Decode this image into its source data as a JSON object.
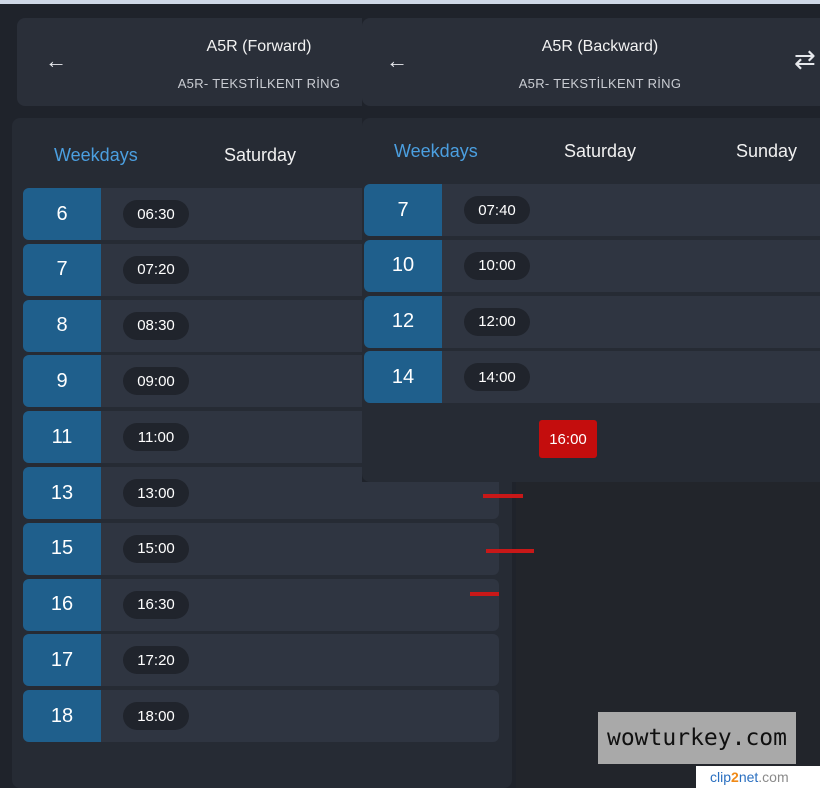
{
  "forward": {
    "title": "A5R (Forward)",
    "subtitle": "A5R- TEKSTİLKENT RİNG",
    "tabs": [
      "Weekdays",
      "Saturday"
    ],
    "rows": [
      {
        "hour": "6",
        "time": "06:30"
      },
      {
        "hour": "7",
        "time": "07:20"
      },
      {
        "hour": "8",
        "time": "08:30"
      },
      {
        "hour": "9",
        "time": "09:00"
      },
      {
        "hour": "11",
        "time": "11:00"
      },
      {
        "hour": "13",
        "time": "13:00"
      },
      {
        "hour": "15",
        "time": "15:00"
      },
      {
        "hour": "16",
        "time": "16:30"
      },
      {
        "hour": "17",
        "time": "17:20"
      },
      {
        "hour": "18",
        "time": "18:00"
      }
    ]
  },
  "backward": {
    "title": "A5R (Backward)",
    "subtitle": "A5R- TEKSTİLKENT RİNG",
    "tabs": [
      "Weekdays",
      "Saturday",
      "Sunday"
    ],
    "rows": [
      {
        "hour": "7",
        "time": "07:40"
      },
      {
        "hour": "10",
        "time": "10:00"
      },
      {
        "hour": "12",
        "time": "12:00"
      },
      {
        "hour": "14",
        "time": "14:00"
      }
    ]
  },
  "annotation": {
    "label": "16:00",
    "color": "#c40d0d"
  },
  "icons": {
    "back": "arrow-left-icon",
    "swap": "swap-direction-icon"
  },
  "colors": {
    "accent_tab": "#4b9fe0",
    "hour_cell": "#1f5f8c",
    "background": "#1f232b"
  },
  "watermark": {
    "text": "wowturkey.com"
  },
  "credit": {
    "a": "clip",
    "b": "2",
    "c": "net",
    "d": ".com"
  }
}
